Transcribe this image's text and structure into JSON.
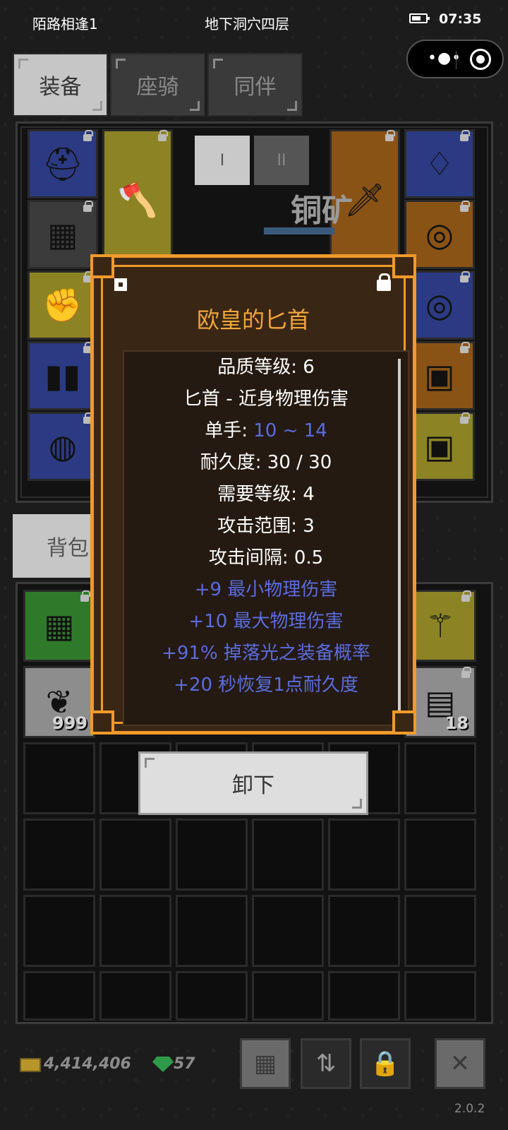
{
  "status_bar": {
    "left_text": "陌路相逢1",
    "center_text": "地下洞穴四层",
    "time": "07:35"
  },
  "capsule": {
    "more_icon": "more-dots-icon",
    "close_icon": "target-circle-icon"
  },
  "tabs": [
    {
      "label": "装备",
      "active": true
    },
    {
      "label": "座骑",
      "active": false
    },
    {
      "label": "同伴",
      "active": false
    }
  ],
  "equipment": {
    "set_buttons": [
      "I",
      "II"
    ],
    "behind_text": "铜矿"
  },
  "backpack": {
    "tab_label": "背包",
    "counts": [
      "999",
      "18"
    ]
  },
  "popup": {
    "title": "欧皇的匕首",
    "quality": "品质等级: 6",
    "type": "匕首 - 近身物理伤害",
    "hand_label": "单手: ",
    "hand_value": "10 ~ 14",
    "durability": "耐久度: 30 / 30",
    "req_level": "需要等级: 4",
    "range": "攻击范围: 3",
    "interval": "攻击间隔: 0.5",
    "bonuses": [
      "+9 最小物理伤害",
      "+10 最大物理伤害",
      "+91% 掉落光之装备概率",
      "+20 秒恢复1点耐久度"
    ],
    "colors": {
      "border": "#f19a2a",
      "title": "#f1a63c",
      "bonus": "#5a6ce0"
    }
  },
  "unequip_button": "卸下",
  "bottom": {
    "gold": "4,414,406",
    "gems": "57",
    "tools": [
      "grid-icon",
      "sort-icon",
      "lock-icon",
      "close-icon"
    ],
    "version": "2.0.2"
  }
}
